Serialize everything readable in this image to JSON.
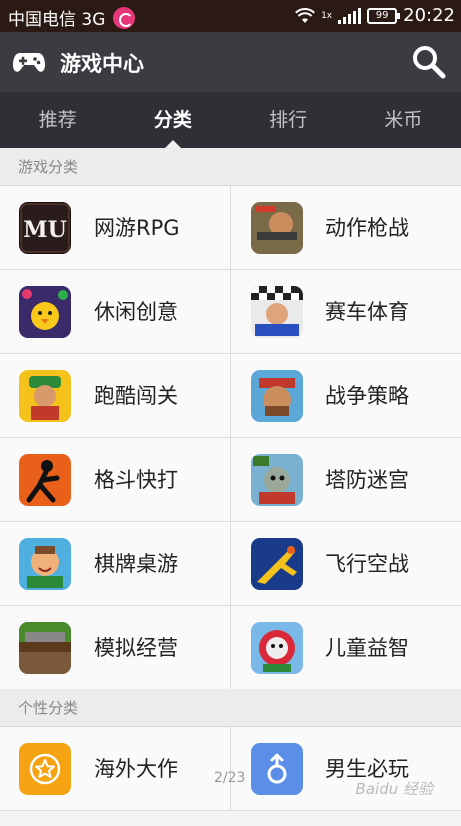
{
  "status_bar": {
    "carrier": "中国电信 3G",
    "network": "1x",
    "battery": "99",
    "time": "20:22"
  },
  "header": {
    "title": "游戏中心",
    "icon": "gamepad-icon",
    "search_icon": "search-icon"
  },
  "tabs": [
    {
      "label": "推荐",
      "active": false
    },
    {
      "label": "分类",
      "active": true
    },
    {
      "label": "排行",
      "active": false
    },
    {
      "label": "米币",
      "active": false
    }
  ],
  "sections": {
    "game_categories": {
      "title": "游戏分类",
      "items": [
        {
          "label": "网游RPG",
          "icon": "mmorpg-icon"
        },
        {
          "label": "动作枪战",
          "icon": "action-shooter-icon"
        },
        {
          "label": "休闲创意",
          "icon": "casual-icon"
        },
        {
          "label": "赛车体育",
          "icon": "racing-icon"
        },
        {
          "label": "跑酷闯关",
          "icon": "parkour-icon"
        },
        {
          "label": "战争策略",
          "icon": "strategy-icon"
        },
        {
          "label": "格斗快打",
          "icon": "fighting-icon"
        },
        {
          "label": "塔防迷宫",
          "icon": "tower-defense-icon"
        },
        {
          "label": "棋牌桌游",
          "icon": "board-game-icon"
        },
        {
          "label": "飞行空战",
          "icon": "air-combat-icon"
        },
        {
          "label": "模拟经营",
          "icon": "simulation-icon"
        },
        {
          "label": "儿童益智",
          "icon": "kids-puzzle-icon"
        }
      ]
    },
    "personal_categories": {
      "title": "个性分类",
      "items": [
        {
          "label": "海外大作",
          "icon": "star-icon",
          "color": "#f5a313"
        },
        {
          "label": "男生必玩",
          "icon": "male-icon",
          "color": "#5b8ee6"
        }
      ]
    }
  },
  "pager": "2/23",
  "watermark": "Baidu 经验"
}
